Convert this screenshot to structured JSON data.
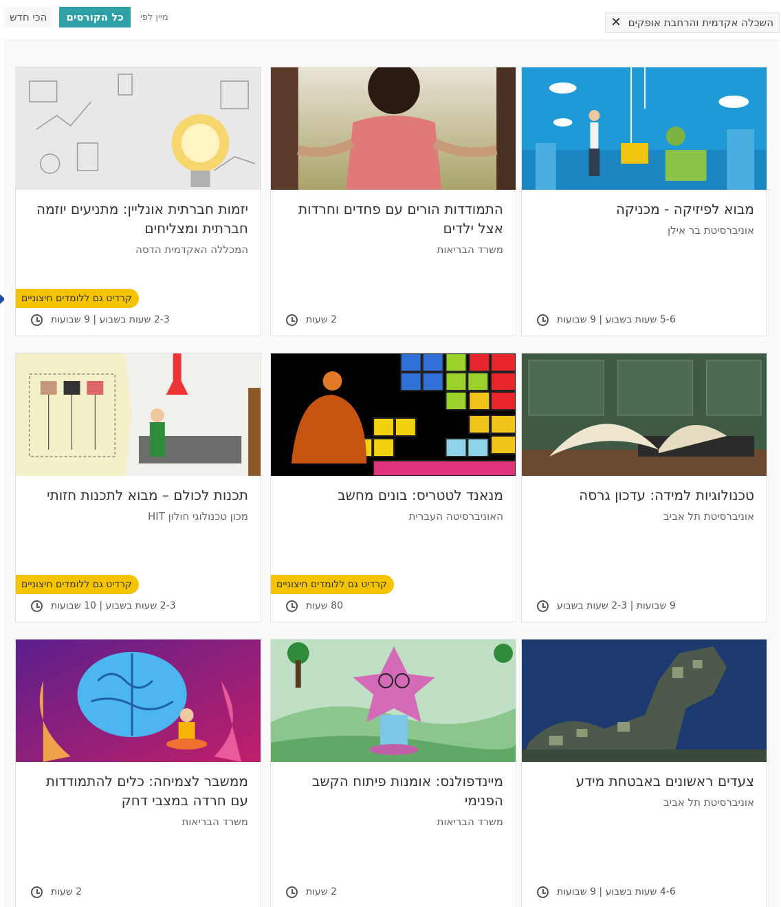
{
  "filters": {
    "active_filter": "השכלה אקדמית והרחבת אופקים",
    "clear_glyph": "✕"
  },
  "sort": {
    "label": "מיין לפי",
    "all_courses": "כל הקורסים",
    "newest": "הכי חדש",
    "active_color": "#2fa0a6"
  },
  "credit_badge_color": "#f5c400",
  "courses": [
    {
      "title": "מבוא לפיזיקה - מכניקה",
      "org": "אוניברסיטת בר אילן",
      "duration": "5-6 שעות בשבוע | 9 שבועות",
      "credit": "",
      "thumb": "physics-illustration"
    },
    {
      "title": "התמודדות הורים עם פחדים וחרדות אצל ילדים",
      "org": "משרד הבריאות",
      "duration": "2 שעות",
      "credit": "",
      "thumb": "parent-child-hands-photo"
    },
    {
      "title": "יזמות חברתית אונליין: מתניעים יוזמה חברתית ומצליחים",
      "org": "המכללה האקדמית הדסה",
      "duration": "2-3 שעות בשבוע | 9 שבועות",
      "credit": "קרדיט גם ללומדים חיצוניים",
      "thumb": "lightbulb-sketch-photo"
    },
    {
      "title": "טכנולוגיות למידה: עדכון גרסה",
      "org": "אוניברסיטת תל אביב",
      "duration": "9 שבועות | 2-3 שעות בשבוע",
      "credit": "",
      "thumb": "book-laptop-photo"
    },
    {
      "title": "מנאנד לטטריס: בונים מחשב",
      "org": "האוניברסיטה העברית",
      "duration": "80 שעות",
      "credit": "קרדיט גם ללומדים חיצוניים",
      "thumb": "tetris-blocks-illustration"
    },
    {
      "title": "תכנות לכולם – מבוא לתכנות חזותי",
      "org": "מכון טכנולוגי חולון HIT",
      "duration": "2-3 שעות בשבוע | 10 שבועות",
      "credit": "קרדיט גם ללומדים חיצוניים",
      "thumb": "visual-programming-illustration"
    },
    {
      "title": "צעדים ראשונים באבטחת מידע",
      "org": "אוניברסיטת תל אביב",
      "duration": "4-6 שעות בשבוע | 9 שבועות",
      "credit": "",
      "thumb": "circuit-trojan-horse-photo"
    },
    {
      "title": "מיינדפולנס: אומנות פיתוח הקשב הפנימי",
      "org": "משרד הבריאות",
      "duration": "2 שעות",
      "credit": "",
      "thumb": "meditating-character-illustration"
    },
    {
      "title": "ממשבר לצמיחה: כלים להתמודדות עם חרדה במצבי דחק",
      "org": "משרד הבריאות",
      "duration": "2 שעות",
      "credit": "",
      "thumb": "brain-meditation-illustration"
    }
  ]
}
